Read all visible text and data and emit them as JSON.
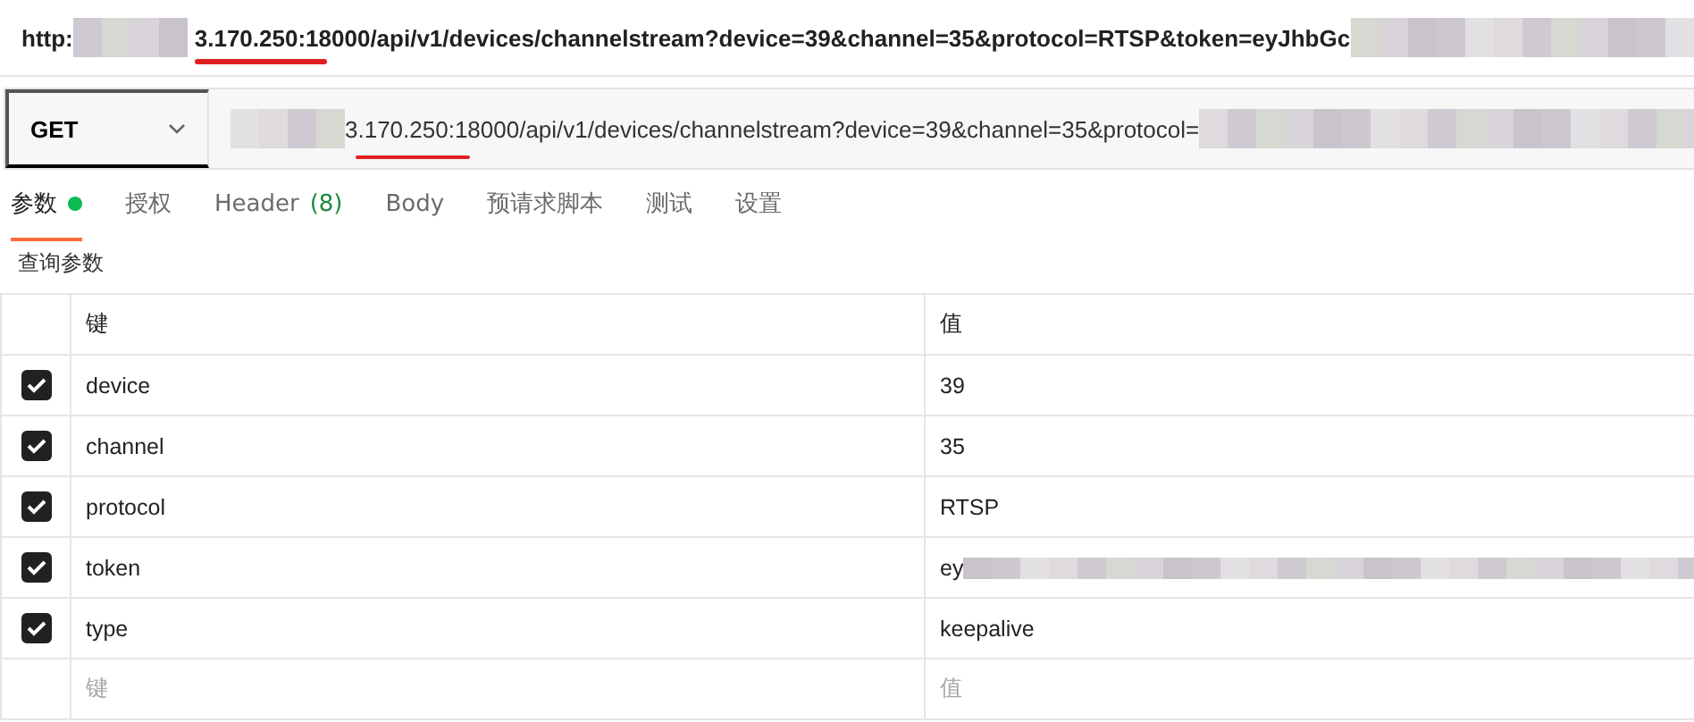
{
  "address_line": {
    "scheme": "http:",
    "text": "3.170.250:18000/api/v1/devices/channelstream?device=39&channel=35&protocol=RTSP&token=eyJhbGc"
  },
  "request": {
    "method": "GET",
    "url": "3.170.250:18000/api/v1/devices/channelstream?device=39&channel=35&protocol="
  },
  "tabs": [
    {
      "label": "参数",
      "selected": true,
      "dot": true
    },
    {
      "label": "授权",
      "selected": false,
      "dot": false
    },
    {
      "label": "Header",
      "count": "(8)",
      "selected": false,
      "dot": false
    },
    {
      "label": "Body",
      "selected": false,
      "dot": false
    },
    {
      "label": "预请求脚本",
      "selected": false,
      "dot": false
    },
    {
      "label": "测试",
      "selected": false,
      "dot": false
    },
    {
      "label": "设置",
      "selected": false,
      "dot": false
    }
  ],
  "section_title": "查询参数",
  "table": {
    "columns": [
      "键",
      "值"
    ],
    "rows": [
      {
        "key": "device",
        "value": "39",
        "checked": true,
        "redacted": false
      },
      {
        "key": "channel",
        "value": "35",
        "checked": true,
        "redacted": false
      },
      {
        "key": "protocol",
        "value": "RTSP",
        "checked": true,
        "redacted": false
      },
      {
        "key": "token",
        "value": "ey",
        "checked": true,
        "redacted": true
      },
      {
        "key": "type",
        "value": "keepalive",
        "checked": true,
        "redacted": false
      }
    ],
    "new_row": {
      "key_placeholder": "键",
      "value_placeholder": "值"
    }
  }
}
